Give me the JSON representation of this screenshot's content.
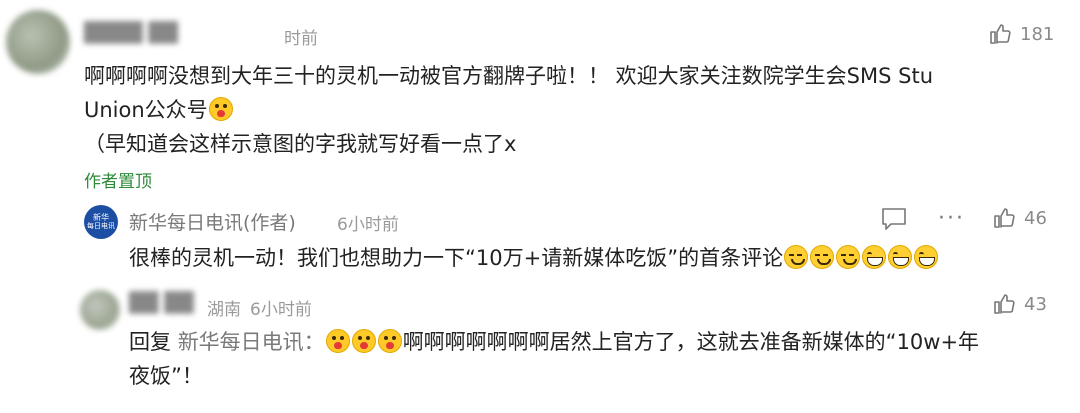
{
  "comment1": {
    "username_obscured": "████ ██",
    "time": "时前",
    "likes": "181",
    "text_line1": "啊啊啊啊没想到大年三十的灵机一动被官方翻牌子啦！！ 欢迎大家关注数院学生会SMS Stu",
    "text_line2": "Union公众号",
    "text_line3": "（早知道会这样示意图的字我就写好看一点了x",
    "pinned_label": "作者置顶"
  },
  "reply1": {
    "avatar_text_top": "新华",
    "avatar_text_bottom": "每日电讯",
    "username": "新华每日电讯(作者)",
    "time": "6小时前",
    "likes": "46",
    "text": "很棒的灵机一动！我们也想助力一下“10万+请新媒体吃饭”的首条评论"
  },
  "reply2": {
    "username_obscured": "██ ██",
    "location": "湖南",
    "time": "6小时前",
    "likes": "43",
    "reply_prefix": "回复",
    "reply_to": "新华每日电讯：",
    "text_line1": "啊啊啊啊啊啊啊居然上官方了，这就去准备新媒体的“10w+年",
    "text_line2": "夜饭”！"
  },
  "colors": {
    "pinned_green": "#2e8b3a",
    "avatar_blue": "#1c4fa3",
    "muted_gray": "#9a9a9a"
  },
  "icons": [
    "thumbs-up-icon",
    "comment-icon",
    "more-icon",
    "surprise-emoji",
    "sweat-emoji",
    "grin-emoji"
  ]
}
